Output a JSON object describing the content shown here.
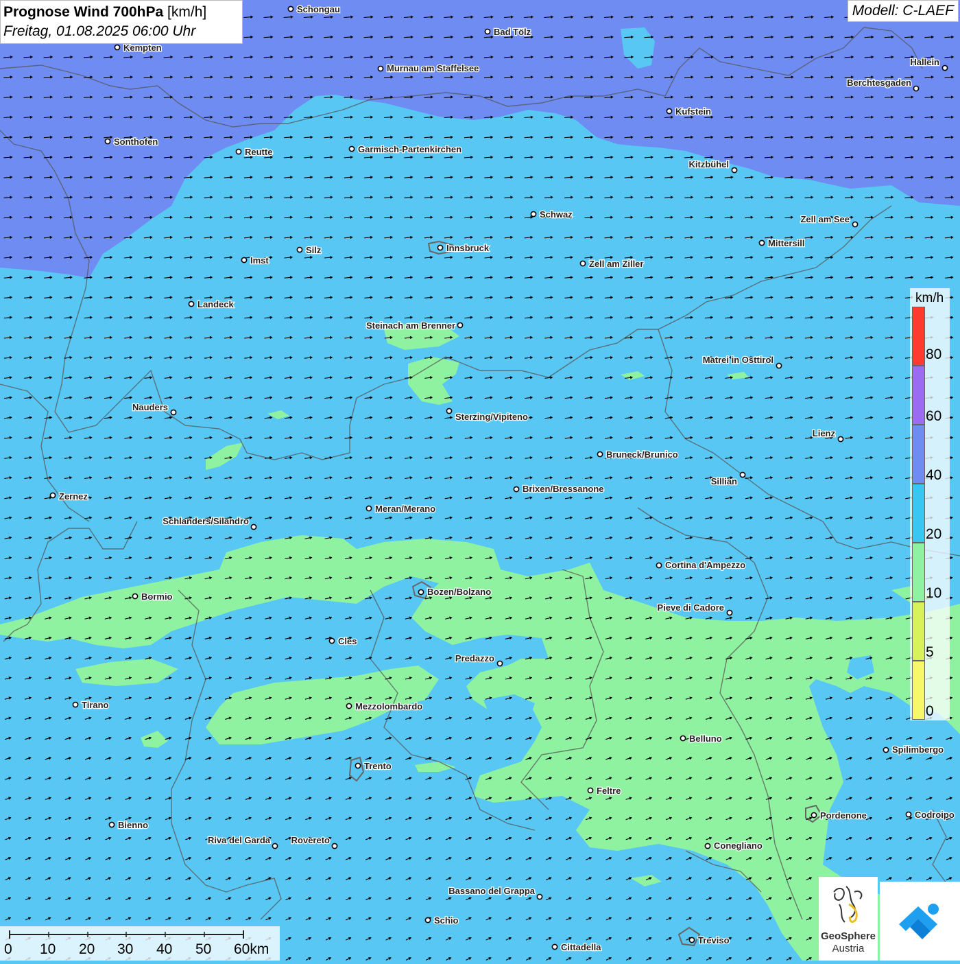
{
  "title": {
    "bold": "Prognose Wind 700hPa",
    "unit": "[km/h]",
    "datetime": "Freitag, 01.08.2025 06:00 Uhr"
  },
  "model": "Modell: C-LAEF",
  "legend": {
    "unit": "km/h",
    "ticks": [
      "80",
      "60",
      "40",
      "20",
      "10",
      "5",
      "0"
    ],
    "colors": [
      "#ff3b30",
      "#9b6bf2",
      "#6f8cf2",
      "#38c6f2",
      "#8ff2a0",
      "#d7f25a",
      "#f7f76a"
    ]
  },
  "scale": {
    "labels": [
      "0",
      "10",
      "20",
      "30",
      "40",
      "50",
      "60km"
    ]
  },
  "logo": {
    "name": "GeoSphere",
    "country": "Austria"
  },
  "colors": {
    "wind_0_5": "#f7f76a",
    "wind_10_20": "#8ff2a0",
    "wind_20_40": "#58c7f4",
    "wind_40_60": "#6f8cf2",
    "arrow": "#000000",
    "border": "#555555"
  },
  "cities": [
    {
      "name": "Schongau"
    },
    {
      "name": "Bad Tölz"
    },
    {
      "name": "Kempten"
    },
    {
      "name": "Murnau am Staffelsee"
    },
    {
      "name": "Hallein"
    },
    {
      "name": "Berchtesgaden"
    },
    {
      "name": "Kufstein"
    },
    {
      "name": "Sonthofen"
    },
    {
      "name": "Reutte"
    },
    {
      "name": "Garmisch-Partenkirchen"
    },
    {
      "name": "Kitzbühel"
    },
    {
      "name": "Schwaz"
    },
    {
      "name": "Zell am See"
    },
    {
      "name": "Mittersill"
    },
    {
      "name": "Innsbruck"
    },
    {
      "name": "Imst"
    },
    {
      "name": "Silz"
    },
    {
      "name": "Zell am Ziller"
    },
    {
      "name": "Landeck"
    },
    {
      "name": "Steinach am Brenner"
    },
    {
      "name": "Matrei in Osttirol"
    },
    {
      "name": "Nauders"
    },
    {
      "name": "Sterzing/Vipiteno"
    },
    {
      "name": "Lienz"
    },
    {
      "name": "Bruneck/Brunico"
    },
    {
      "name": "Sillian"
    },
    {
      "name": "Brixen/Bressanone"
    },
    {
      "name": "Zernez"
    },
    {
      "name": "Meran/Merano"
    },
    {
      "name": "Schlanders/Silandro"
    },
    {
      "name": "Cortina d'Ampezzo"
    },
    {
      "name": "Bozen/Bolzano"
    },
    {
      "name": "Bormio"
    },
    {
      "name": "Pieve di Cadore"
    },
    {
      "name": "Cles"
    },
    {
      "name": "Predazzo"
    },
    {
      "name": "Tirano"
    },
    {
      "name": "Mezzolombardo"
    },
    {
      "name": "Belluno"
    },
    {
      "name": "Spilimbergo"
    },
    {
      "name": "Trento"
    },
    {
      "name": "Feltre"
    },
    {
      "name": "Pordenone"
    },
    {
      "name": "Codroipo"
    },
    {
      "name": "Bienno"
    },
    {
      "name": "Riva del Garda"
    },
    {
      "name": "Rovereto"
    },
    {
      "name": "Conegliano"
    },
    {
      "name": "Bassano del Grappa"
    },
    {
      "name": "Schio"
    },
    {
      "name": "Treviso"
    },
    {
      "name": "Cittadella"
    }
  ]
}
